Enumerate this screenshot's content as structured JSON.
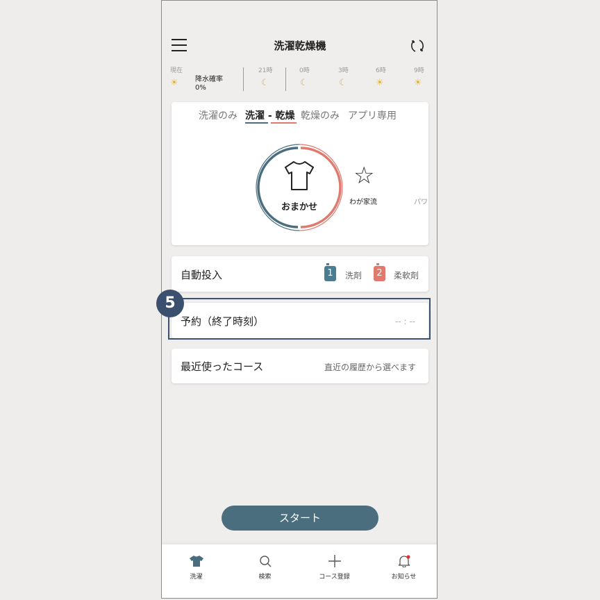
{
  "header": {
    "title": "洗濯乾燥機"
  },
  "weather": {
    "now_label": "現在",
    "precip_label": "降水確率",
    "precip_value": "0%",
    "hours": [
      "21時",
      "0時",
      "3時",
      "6時",
      "9時"
    ]
  },
  "course_tabs": [
    "洗濯のみ",
    "洗濯 - 乾燥",
    "乾燥のみ",
    "アプリ専用"
  ],
  "course_selector": {
    "main_label": "おまかせ",
    "second_label": "わが家流",
    "third_label": "パワ"
  },
  "auto_dose": {
    "label": "自動投入",
    "items": [
      {
        "num": "1",
        "label": "洗剤",
        "color": "#4a7d94"
      },
      {
        "num": "2",
        "label": "柔軟剤",
        "color": "#e07a6f"
      }
    ]
  },
  "reservation": {
    "label": "予約（終了時刻）",
    "value": "-- : --"
  },
  "recent": {
    "label": "最近使ったコース",
    "hint": "直近の履歴から選べます"
  },
  "start_button": "スタート",
  "step_marker": "5",
  "bottom_nav": [
    {
      "label": "洗濯",
      "icon": "shirt-icon"
    },
    {
      "label": "検索",
      "icon": "search-icon"
    },
    {
      "label": "コース登録",
      "icon": "plus-icon"
    },
    {
      "label": "お知らせ",
      "icon": "bell-icon"
    }
  ],
  "colors": {
    "accent_blue": "#4b6e7e",
    "accent_red": "#e07a6f",
    "highlight": "#3b4f6f"
  }
}
